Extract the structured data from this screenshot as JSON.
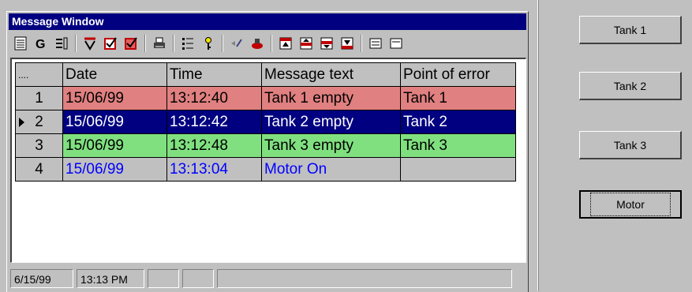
{
  "window": {
    "title": "Message Window"
  },
  "toolbar": {
    "icons": [
      "report-icon",
      "group-icon",
      "columns-icon",
      "filter-icon",
      "acknowledge-icon",
      "group-acknowledge-icon",
      "print-icon",
      "sort-icon",
      "key-icon",
      "sequence-icon",
      "horn-icon",
      "first-row-icon",
      "prev-row-icon",
      "next-row-icon",
      "last-row-icon",
      "info-icon",
      "archive-icon"
    ]
  },
  "grid": {
    "corner": "....",
    "headers": [
      "Date",
      "Time",
      "Message text",
      "Point of error"
    ],
    "rows": [
      {
        "num": "1",
        "date": "15/06/99",
        "time": "13:12:40",
        "text": "Tank 1 empty",
        "point": "Tank 1",
        "bg": "#e08080",
        "fg": "#000000"
      },
      {
        "num": "2",
        "date": "15/06/99",
        "time": "13:12:42",
        "text": "Tank 2 empty",
        "point": "Tank 2",
        "bg": "#000080",
        "fg": "#ffffff"
      },
      {
        "num": "3",
        "date": "15/06/99",
        "time": "13:12:48",
        "text": "Tank 3 empty",
        "point": "Tank 3",
        "bg": "#80e080",
        "fg": "#000000"
      },
      {
        "num": "4",
        "date": "15/06/99",
        "time": "13:13:04",
        "text": "Motor On",
        "point": "",
        "bg": "#c0c0c0",
        "fg": "#0000ff"
      }
    ]
  },
  "status": {
    "date": "6/15/99",
    "time": "13:13 PM"
  },
  "buttons": {
    "tank1": "Tank 1",
    "tank2": "Tank 2",
    "tank3": "Tank 3",
    "motor": "Motor"
  }
}
